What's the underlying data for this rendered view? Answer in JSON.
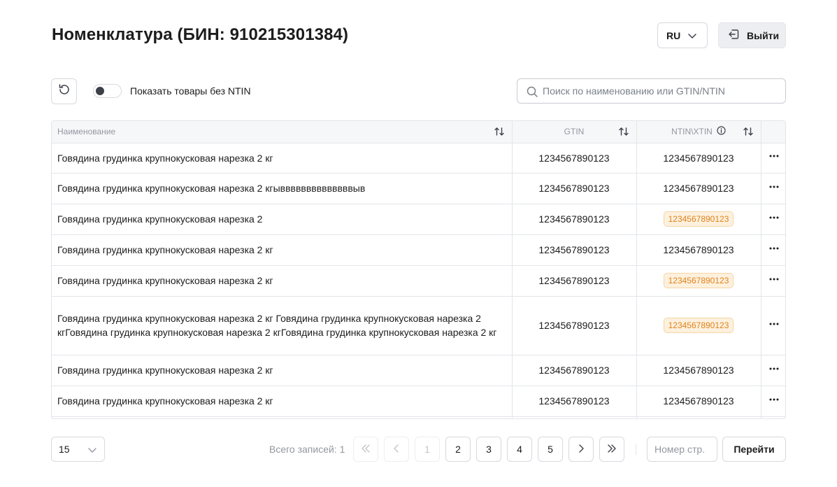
{
  "header": {
    "title": "Номенклатура (БИН: 910215301384)",
    "language": "RU",
    "logout_label": "Выйти"
  },
  "toolbar": {
    "toggle_label": "Показать товары без NTIN",
    "toggle_on": false,
    "search_placeholder": "Поиск по наименованию или GTIN/NTIN"
  },
  "table": {
    "columns": {
      "name": "Наименование",
      "gtin": "GTIN",
      "ntin": "NTIN\\XTIN"
    },
    "rows": [
      {
        "name": "Говядина грудинка крупнокусковая нарезка 2 кг",
        "gtin": "1234567890123",
        "ntin": "1234567890123",
        "ntin_highlight": false
      },
      {
        "name": "Говядина грудинка крупнокусковая нарезка 2 кгыввввввввввввввыв",
        "gtin": "1234567890123",
        "ntin": "1234567890123",
        "ntin_highlight": false
      },
      {
        "name": "Говядина грудинка крупнокусковая нарезка 2",
        "gtin": "1234567890123",
        "ntin": "1234567890123",
        "ntin_highlight": true
      },
      {
        "name": "Говядина грудинка крупнокусковая нарезка 2 кг",
        "gtin": "1234567890123",
        "ntin": "1234567890123",
        "ntin_highlight": false
      },
      {
        "name": "Говядина грудинка крупнокусковая нарезка 2 кг",
        "gtin": "1234567890123",
        "ntin": "1234567890123",
        "ntin_highlight": true
      },
      {
        "name": "Говядина грудинка крупнокусковая нарезка 2 кг Говядина грудинка крупнокусковая нарезка 2 кгГовядина грудинка крупнокусковая нарезка 2 кгГовядина грудинка крупнокусковая нарезка 2 кг",
        "gtin": "1234567890123",
        "ntin": "1234567890123",
        "ntin_highlight": true
      },
      {
        "name": "Говядина грудинка крупнокусковая нарезка 2 кг",
        "gtin": "1234567890123",
        "ntin": "1234567890123",
        "ntin_highlight": false
      },
      {
        "name": "Говядина грудинка крупнокусковая нарезка 2 кг",
        "gtin": "1234567890123",
        "ntin": "1234567890123",
        "ntin_highlight": false
      },
      {
        "name": "",
        "gtin": "",
        "ntin": "",
        "ntin_highlight": false
      }
    ]
  },
  "pagination": {
    "page_size": "15",
    "total_label": "Всего записей: 1",
    "pages": [
      "1",
      "2",
      "3",
      "4",
      "5"
    ],
    "current_page": "1",
    "page_input_placeholder": "Номер стр.",
    "go_label": "Перейти"
  },
  "colors": {
    "highlight_bg": "#fdf1de",
    "highlight_text": "#e0821c",
    "border": "#e3e5e9"
  }
}
